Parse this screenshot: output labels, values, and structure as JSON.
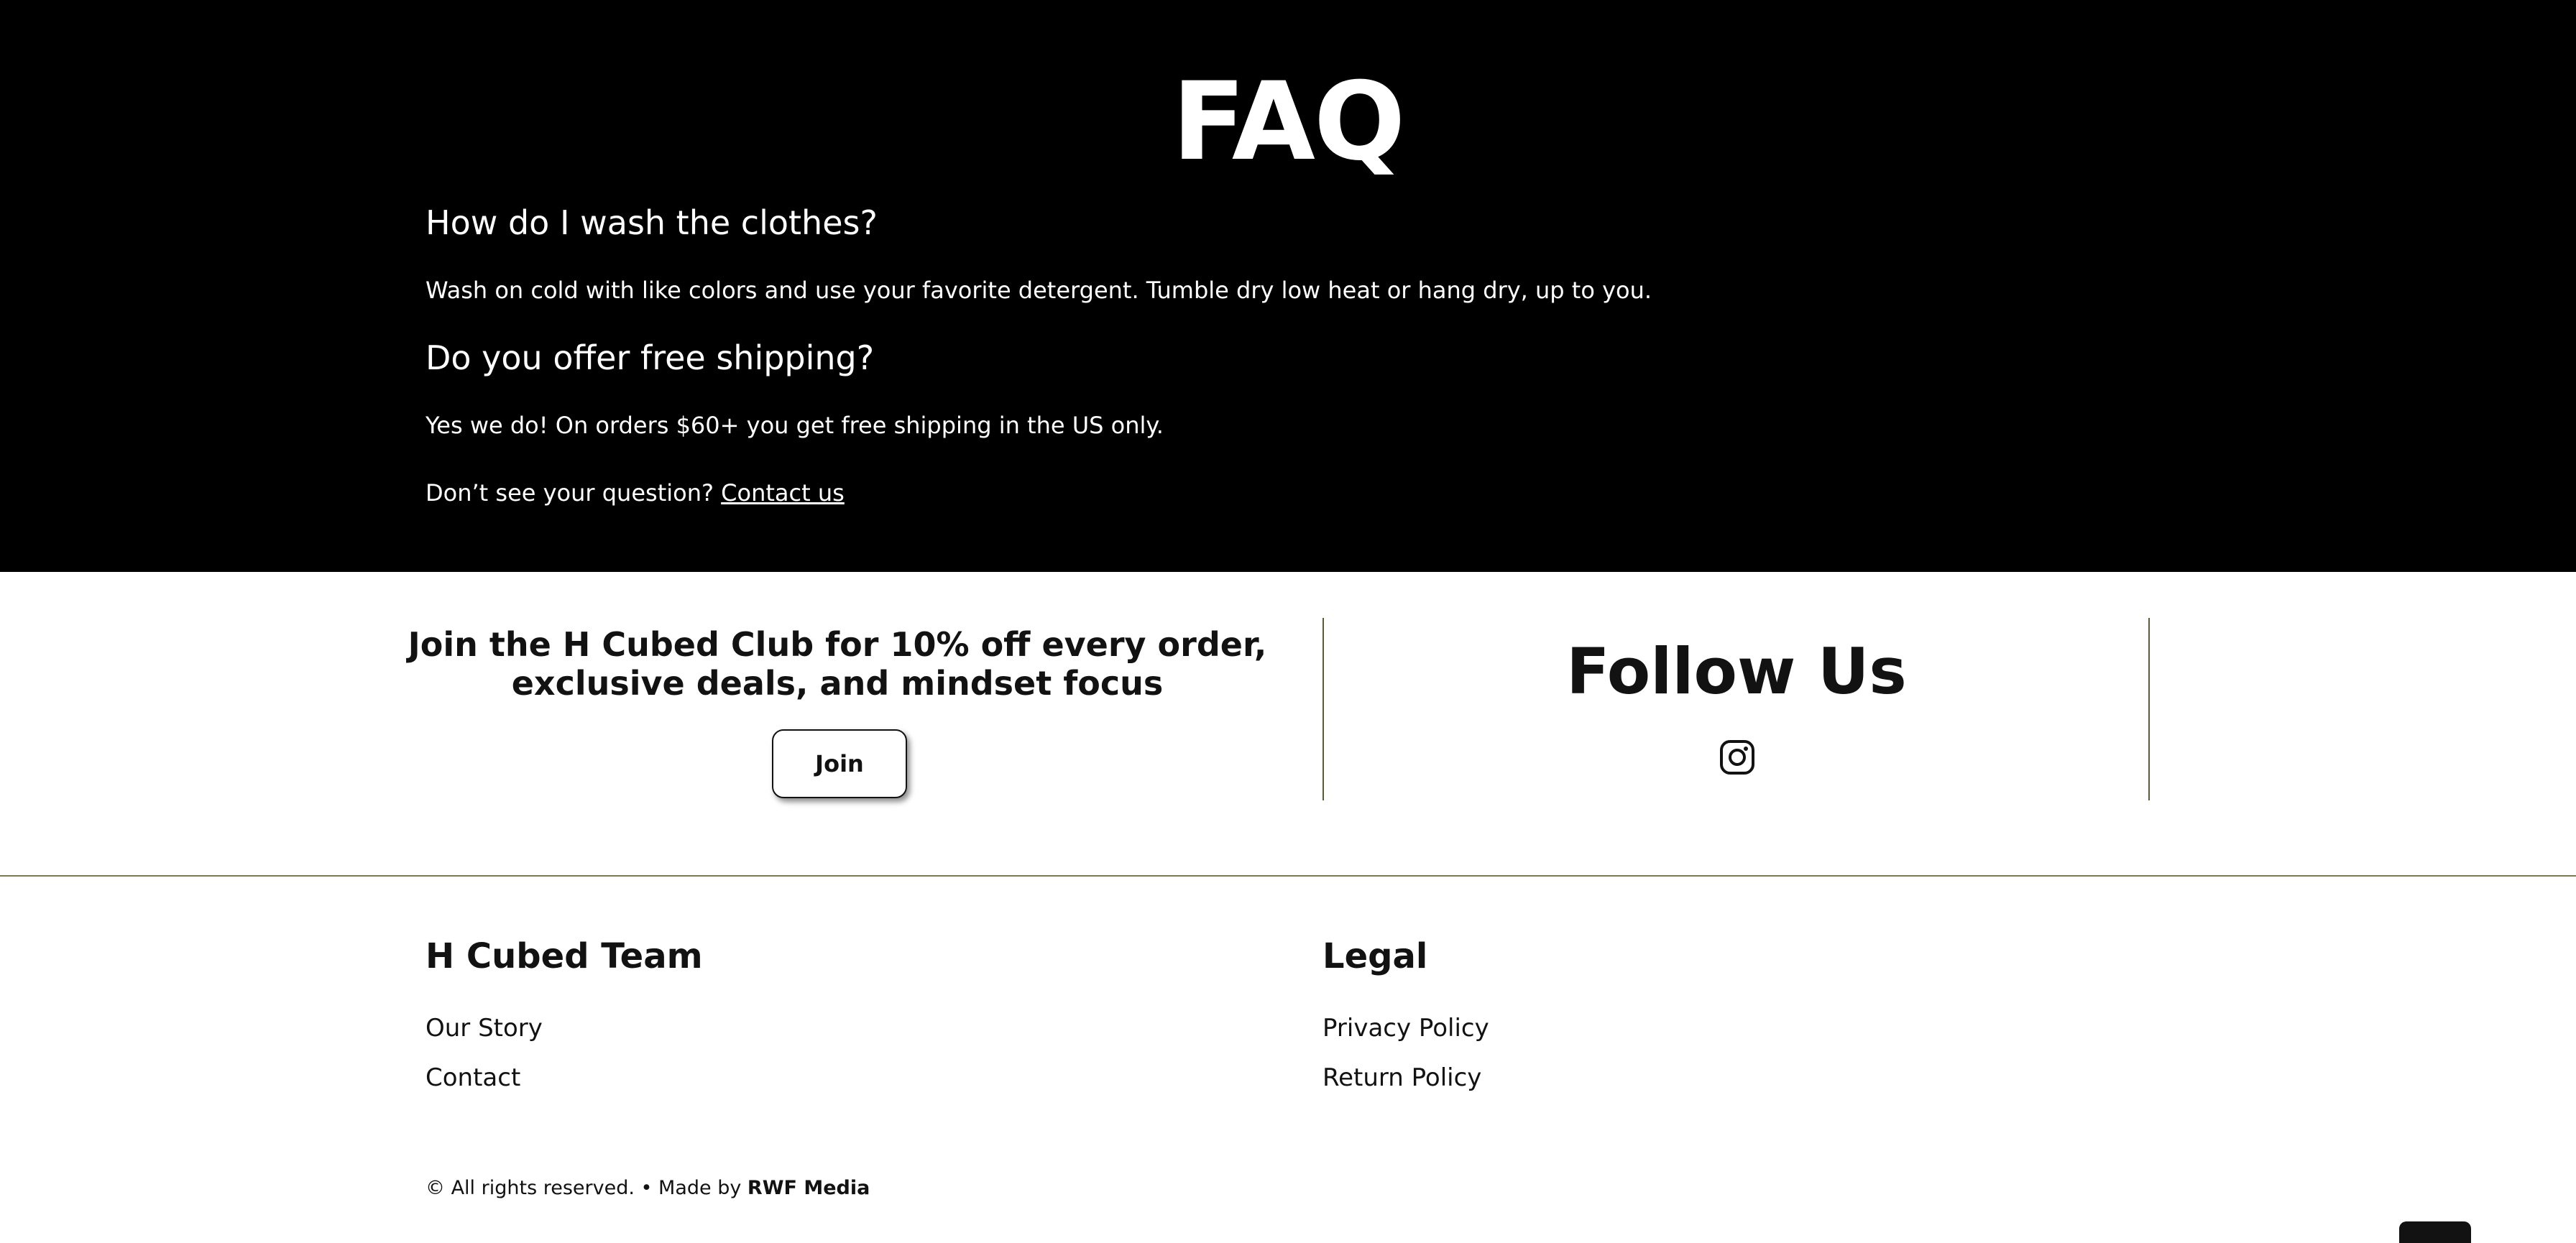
{
  "faq": {
    "title": "FAQ",
    "items": [
      {
        "question": "How do I wash the clothes?",
        "answer": "Wash on cold with like colors and use your favorite detergent. Tumble dry low heat or hang dry, up to you."
      },
      {
        "question": "Do you offer free shipping?",
        "answer": "Yes we do! On orders $60+ you get free shipping in the US only."
      }
    ],
    "cta_text": "Don’t see your question?",
    "cta_link": "Contact us"
  },
  "club": {
    "line1": "Join the H Cubed Club for 10% off every order,",
    "line2": "exclusive deals, and mindset focus",
    "join_label": "Join"
  },
  "follow": {
    "title": "Follow Us",
    "icon": "instagram-icon"
  },
  "footer": {
    "team": {
      "heading": "H Cubed Team",
      "links": [
        "Our Story",
        "Contact"
      ]
    },
    "legal": {
      "heading": "Legal",
      "links": [
        "Privacy Policy",
        "Return Policy"
      ]
    },
    "copyright": "© All rights reserved. • Made by",
    "maker": "RWF Media"
  },
  "colors": {
    "faq_background": "#000000",
    "text": "#121212",
    "divider": "#7a7a55"
  }
}
